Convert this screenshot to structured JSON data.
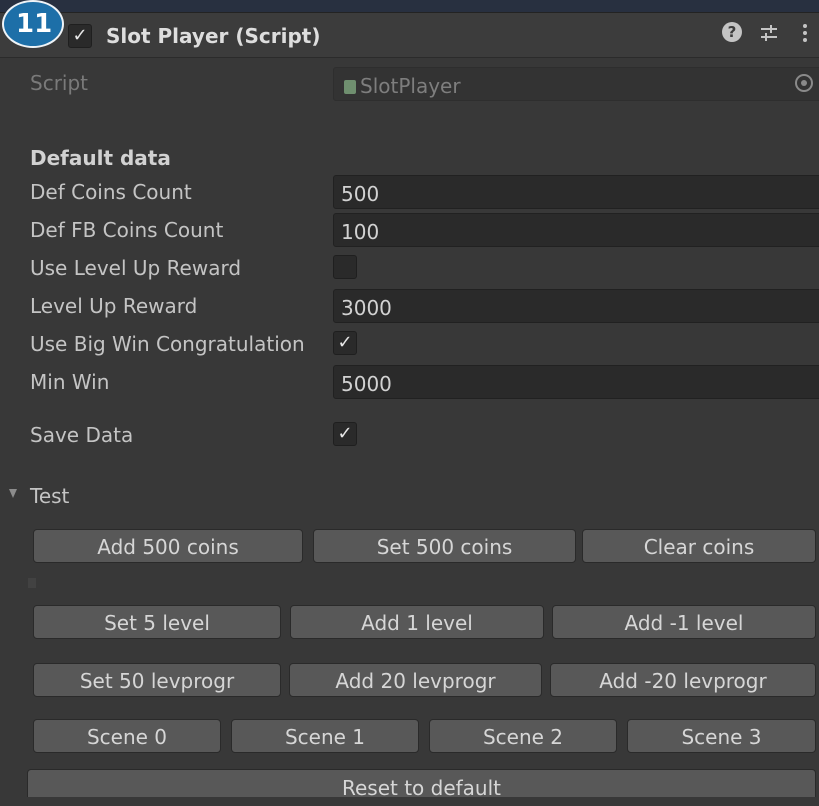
{
  "badge": "11",
  "header": {
    "enabled": true,
    "title": "Slot Player (Script)",
    "icons": [
      "help-icon",
      "presets-icon",
      "more-menu-icon"
    ]
  },
  "script_field": {
    "label": "Script",
    "value": "SlotPlayer"
  },
  "section_title": "Default data",
  "fields": {
    "def_coins_label": "Def Coins Count",
    "def_coins_value": "500",
    "def_fb_label": "Def FB Coins Count",
    "def_fb_value": "100",
    "use_level_reward_label": "Use Level Up Reward",
    "use_level_reward_checked": false,
    "level_reward_label": "Level Up Reward",
    "level_reward_value": "3000",
    "big_win_label": "Use Big Win Congratulation",
    "big_win_checked": true,
    "min_win_label": "Min Win",
    "min_win_value": "5000",
    "save_data_label": "Save Data",
    "save_data_checked": true
  },
  "test": {
    "label": "Test",
    "row1": [
      "Add 500 coins",
      "Set 500 coins",
      "Clear coins"
    ],
    "row2": [
      "Set 5 level",
      "Add 1 level",
      "Add -1 level"
    ],
    "row3": [
      "Set 50 levprogr",
      "Add 20 levprogr",
      "Add -20 levprogr"
    ],
    "row4": [
      "Scene 0",
      "Scene 1",
      "Scene 2",
      "Scene 3"
    ],
    "reset": "Reset to default"
  },
  "check_glyph": "✓",
  "colors": {
    "badge": "#1d6fa8",
    "panel": "#383838",
    "field": "#2a2a2a",
    "button": "#585858"
  }
}
